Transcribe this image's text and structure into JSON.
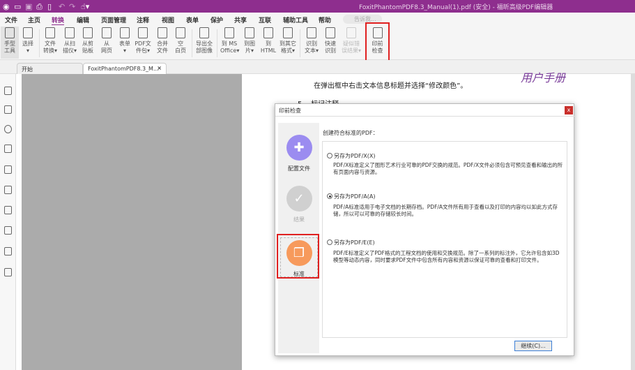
{
  "title": "FoxitPhantomPDF8.3_Manual(1).pdf (安全) - 福昕高级PDF编辑器",
  "menu": [
    "文件",
    "主页",
    "转换",
    "编辑",
    "页面管理",
    "注释",
    "视图",
    "表单",
    "保护",
    "共享",
    "互联",
    "辅助工具",
    "帮助"
  ],
  "active_menu": "转换",
  "search_placeholder": "告诉我...",
  "ribbon": [
    {
      "l1": "手型",
      "l2": "工具"
    },
    {
      "l1": "选择",
      "l2": "▾"
    },
    {
      "l1": "文件",
      "l2": "转换▾"
    },
    {
      "l1": "从扫",
      "l2": "描仪▾"
    },
    {
      "l1": "从剪",
      "l2": "贴板"
    },
    {
      "l1": "从",
      "l2": "网页"
    },
    {
      "l1": "表单",
      "l2": "▾"
    },
    {
      "l1": "PDF文",
      "l2": "件包▾"
    },
    {
      "l1": "合并",
      "l2": "文件"
    },
    {
      "l1": "空",
      "l2": "白页"
    },
    {
      "l1": "导出全",
      "l2": "部图像"
    },
    {
      "l1": "到 MS",
      "l2": "Office▾"
    },
    {
      "l1": "到图",
      "l2": "片▾"
    },
    {
      "l1": "到",
      "l2": "HTML"
    },
    {
      "l1": "到其它",
      "l2": "格式▾"
    },
    {
      "l1": "识别",
      "l2": "文本▾"
    },
    {
      "l1": "快速",
      "l2": "识别"
    },
    {
      "l1": "疑似错",
      "l2": "误结果▾"
    },
    {
      "l1": "印前",
      "l2": "检查"
    }
  ],
  "tabs": {
    "start": "开始",
    "doc": "FoxitPhantomPDF8.3_M...",
    "close": "×"
  },
  "page": {
    "header": "用户手册",
    "line1": "在弹出框中右击文本信息标题并选择“修改颜色”。",
    "sec_num": "5",
    "sec_title": "标记注释"
  },
  "dialog": {
    "title": "印前检查",
    "close": "x",
    "steps": [
      {
        "label": "配置文件",
        "color": "#9b8cf0"
      },
      {
        "label": "结果",
        "color": "#d0d0d0"
      },
      {
        "label": "标准",
        "color": "#f79a5c"
      }
    ],
    "lead": "创建符合标准的PDF：",
    "options": [
      {
        "label": "另存为PDF/X(X)",
        "selected": false,
        "desc": "PDF/X标准定义了图形艺术行业可靠的PDF交换的规范。PDF/X文件必须包含可预见查看和输出的所有页面内容与资源。"
      },
      {
        "label": "另存为PDF/A(A)",
        "selected": true,
        "desc": "PDF/A标准适用于电子文档的长期存档。PDF/A文件所有用于查看以及打印的内容均以如此方式存储，所以可以可靠的存储较长时间。"
      },
      {
        "label": "另存为PDF/E(E)",
        "selected": false,
        "desc": "PDF/E标准定义了PDF格式的工程文档的使用和交换规范。除了一系列的标注外，它允许包含如3D模型等动态内容，同时要求PDF文件中包含所有内容和资源以保证可靠的查看和打印文件。"
      }
    ],
    "continue": "继续(C)..."
  }
}
